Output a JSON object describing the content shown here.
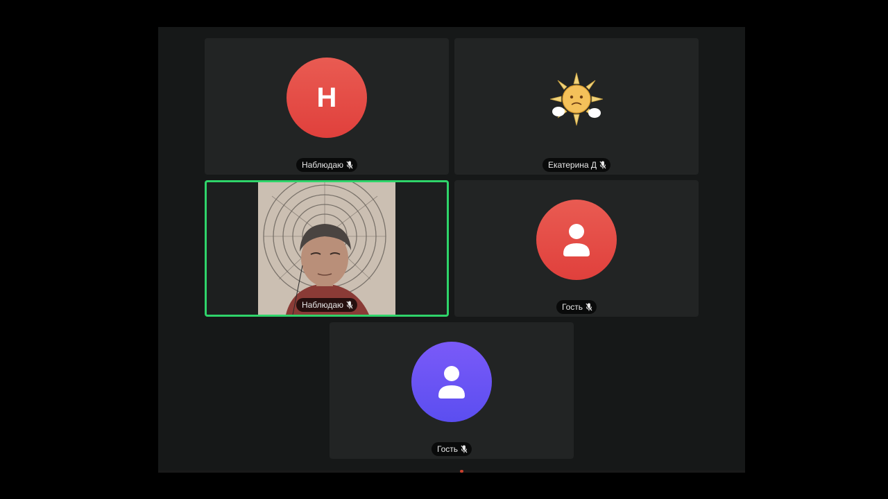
{
  "participants": [
    {
      "name": "Наблюдаю",
      "initial": "Н",
      "avatar_type": "letter",
      "avatar_color": "#e24c45",
      "mic_icon": "mic-muted-icon"
    },
    {
      "name": "Екатерина Д",
      "avatar_type": "sun-image",
      "mic_icon": "mic-muted-icon"
    },
    {
      "name": "Наблюдаю",
      "avatar_type": "video",
      "active_speaker": true,
      "highlight_color": "#2fd46a",
      "mic_icon": "mic-muted-icon"
    },
    {
      "name": "Гость",
      "avatar_type": "person-icon",
      "avatar_color": "#e24c45",
      "mic_icon": "mic-muted-icon"
    },
    {
      "name": "Гость",
      "avatar_type": "person-icon",
      "avatar_color": "#6b55f5",
      "mic_icon": "mic-muted-icon"
    }
  ],
  "colors": {
    "background": "#000000",
    "stage": "#161818",
    "tile": "#222424",
    "active_border": "#2fd46a"
  }
}
